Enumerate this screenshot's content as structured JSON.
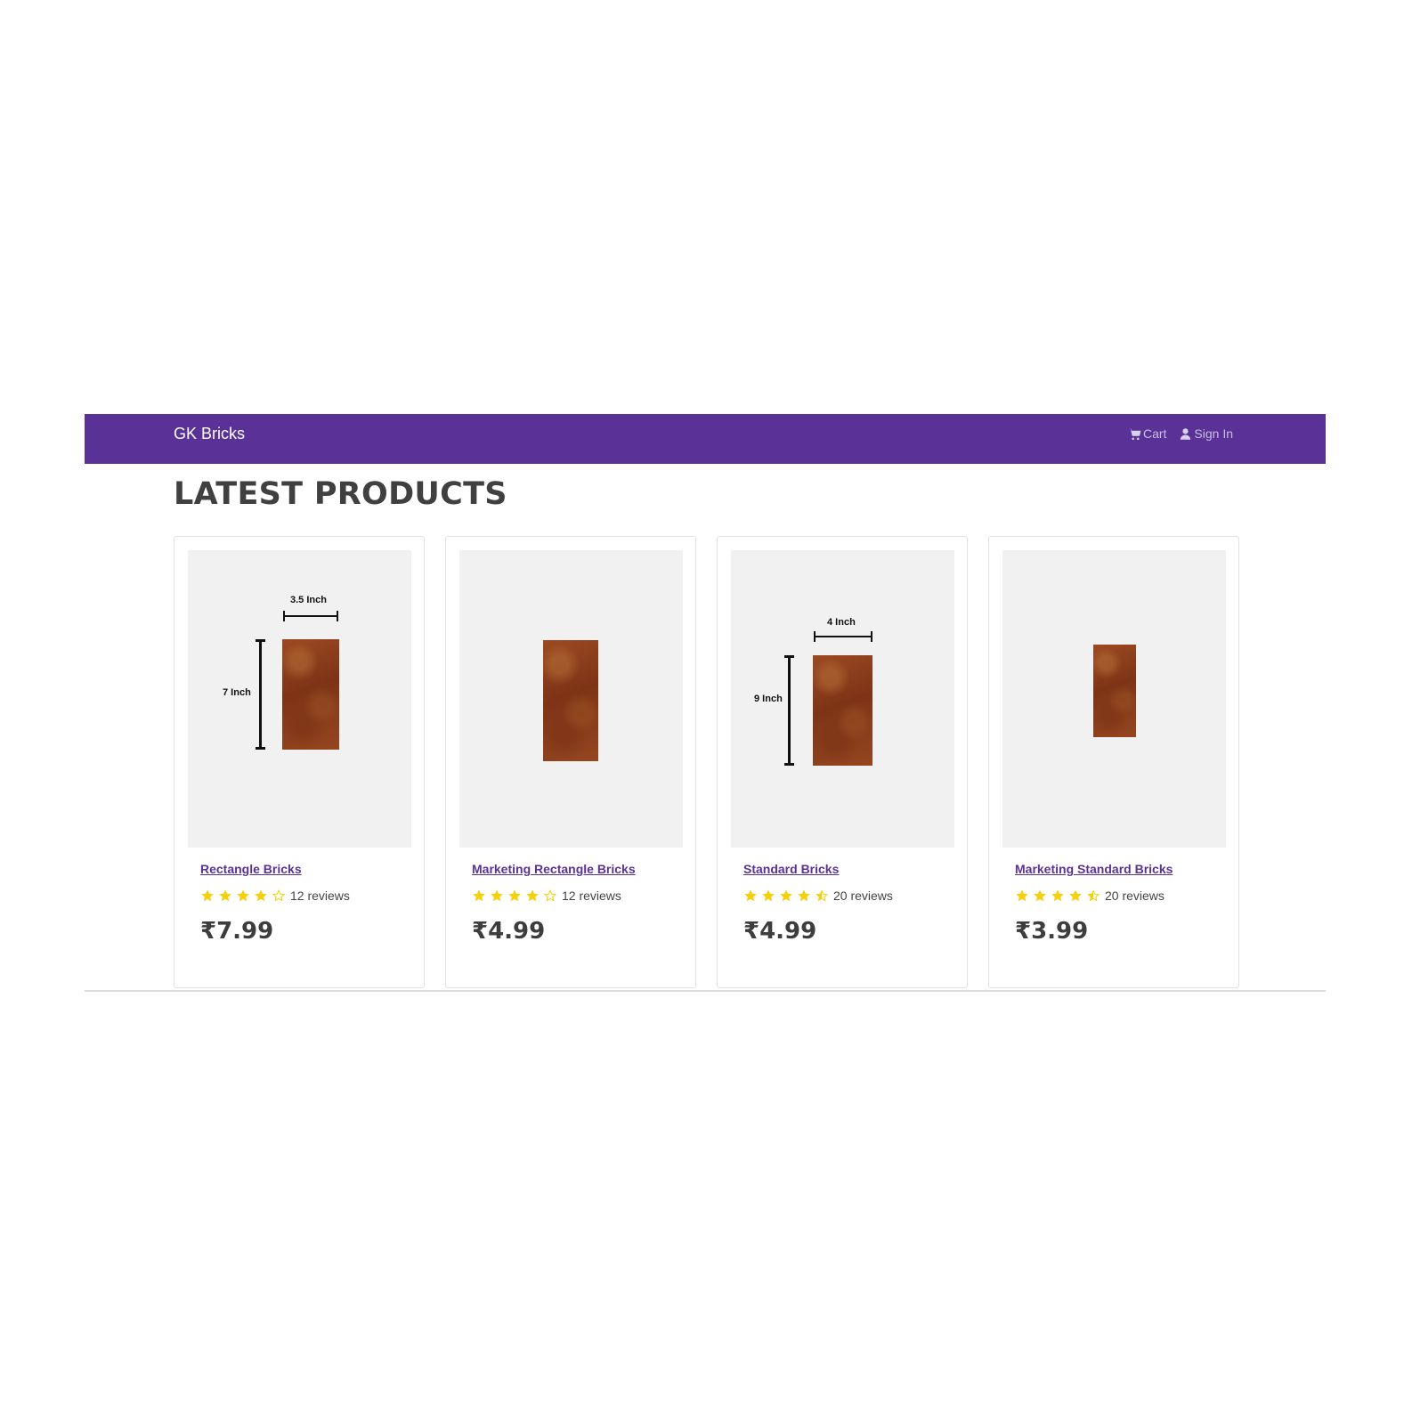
{
  "navbar": {
    "brand": "GK Bricks",
    "cart_label": "Cart",
    "signin_label": "Sign In",
    "background_color": "#5a3196"
  },
  "main": {
    "title": "LATEST PRODUCTS"
  },
  "products": [
    {
      "name": "Rectangle Bricks",
      "rating": 4,
      "rating_icons": [
        "star-icon",
        "star-icon",
        "star-icon",
        "star-icon",
        "star-outline-icon"
      ],
      "reviews": "12 reviews",
      "price": "₹7.99",
      "image_labels": {
        "width": "3.5 Inch",
        "height": "7 Inch"
      }
    },
    {
      "name": "Marketing Rectangle Bricks",
      "rating": 4,
      "rating_icons": [
        "star-icon",
        "star-icon",
        "star-icon",
        "star-icon",
        "star-outline-icon"
      ],
      "reviews": "12 reviews",
      "price": "₹4.99",
      "image_labels": {}
    },
    {
      "name": "Standard Bricks",
      "rating": 4.5,
      "rating_icons": [
        "star-icon",
        "star-icon",
        "star-icon",
        "star-icon",
        "star-half-icon"
      ],
      "reviews": "20 reviews",
      "price": "₹4.99",
      "image_labels": {
        "width": "4 Inch",
        "height": "9 Inch"
      }
    },
    {
      "name": "Marketing Standard Bricks",
      "rating": 4.5,
      "rating_icons": [
        "star-icon",
        "star-icon",
        "star-icon",
        "star-icon",
        "star-half-icon"
      ],
      "reviews": "20 reviews",
      "price": "₹3.99",
      "image_labels": {}
    }
  ],
  "colors": {
    "accent": "#5a3196",
    "star": "#f5d00f",
    "image_background": "#f1f1f1"
  }
}
